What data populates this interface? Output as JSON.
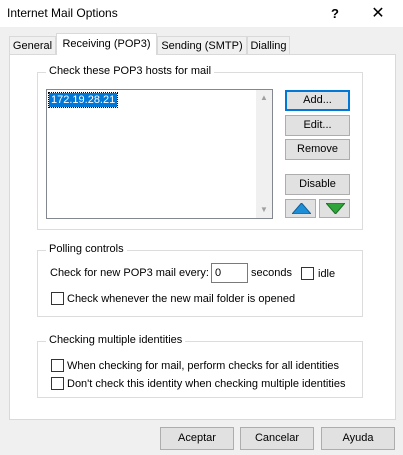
{
  "window": {
    "title": "Internet Mail Options",
    "help_glyph": "?",
    "close_glyph": "✕"
  },
  "tabs": [
    {
      "label": "General"
    },
    {
      "label": "Receiving (POP3)"
    },
    {
      "label": "Sending (SMTP)"
    },
    {
      "label": "Dialling"
    }
  ],
  "hosts": {
    "legend": "Check these POP3 hosts for mail",
    "items": [
      "172.19.28.21"
    ],
    "add_label": "Add...",
    "edit_label": "Edit...",
    "remove_label": "Remove",
    "disable_label": "Disable",
    "up_icon": "arrow-up-icon",
    "down_icon": "arrow-down-icon",
    "up_color": "#1e8fd6",
    "down_color": "#2ea43a"
  },
  "polling": {
    "legend": "Polling controls",
    "check_every_label": "Check for new POP3 mail every:",
    "check_every_value": "0",
    "seconds_label": "seconds",
    "idle_label": "idle",
    "idle_checked": false,
    "new_folder_label": "Check whenever the new mail folder is opened",
    "new_folder_checked": false
  },
  "identities": {
    "legend": "Checking multiple identities",
    "all_identities_label": "When checking for mail, perform checks for all identities",
    "all_identities_checked": false,
    "dont_check_label": "Don't check this identity when checking multiple identities",
    "dont_check_checked": false
  },
  "footer": {
    "accept_label": "Aceptar",
    "cancel_label": "Cancelar",
    "help_label": "Ayuda"
  }
}
